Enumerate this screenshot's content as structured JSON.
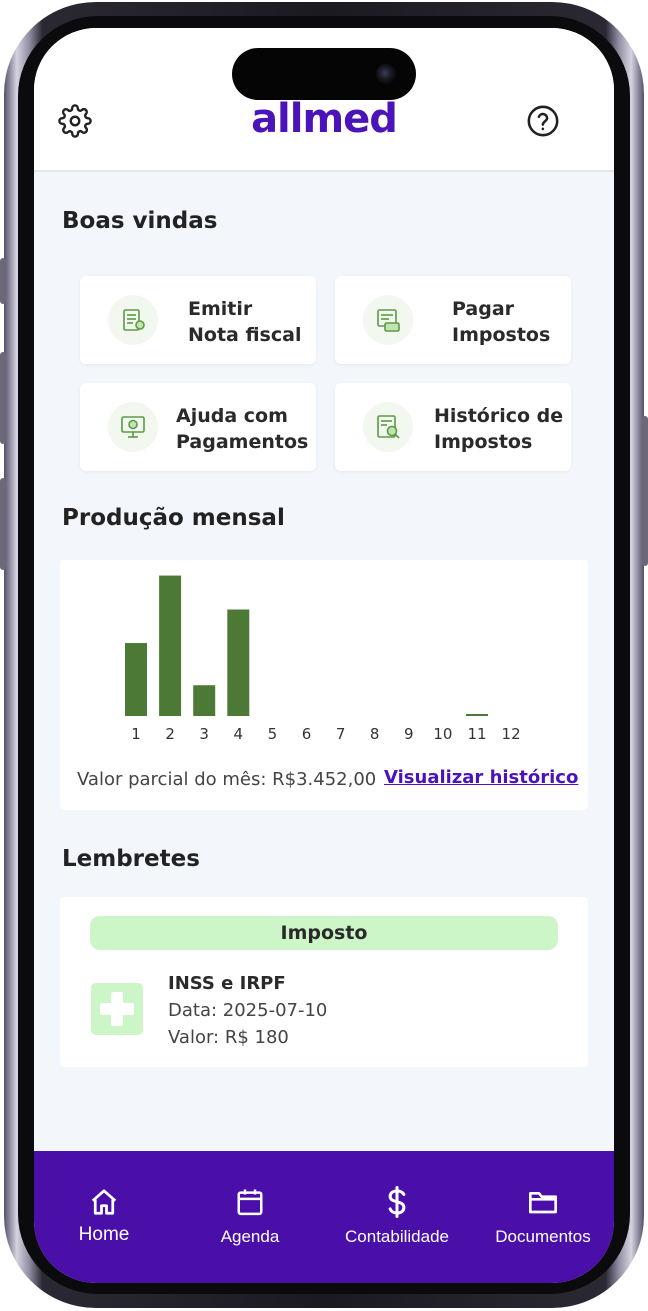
{
  "app": {
    "logo_text": "allmed",
    "brand_color": "#4a14b8",
    "accent_green": "#4c7a36"
  },
  "header": {
    "settings_icon": "gear-icon",
    "help_icon": "help-circle-icon"
  },
  "welcome": {
    "title": "Boas vindas",
    "actions": [
      {
        "label": "Emitir\nNota fiscal",
        "icon": "invoice-icon"
      },
      {
        "label": "Pagar\nImpostos",
        "icon": "tax-payment-icon"
      },
      {
        "label": "Ajuda com\nPagamentos",
        "icon": "payment-help-icon"
      },
      {
        "label": "Histórico de\nImpostos",
        "icon": "tax-history-icon"
      }
    ]
  },
  "production": {
    "title": "Produção mensal",
    "partial_label": "Valor parcial do mês: R$3.452,00",
    "history_link": "Visualizar histórico"
  },
  "chart_data": {
    "type": "bar",
    "title": "",
    "xlabel": "",
    "ylabel": "",
    "categories": [
      "1",
      "2",
      "3",
      "4",
      "5",
      "6",
      "7",
      "8",
      "9",
      "10",
      "11",
      "12"
    ],
    "values": [
      1850,
      3560,
      780,
      2700,
      0,
      0,
      0,
      0,
      0,
      0,
      40,
      0
    ],
    "ylim": [
      0,
      3600
    ],
    "grid": false,
    "bar_color": "#4c7a36"
  },
  "reminders": {
    "title": "Lembretes",
    "items": [
      {
        "tag": "Imposto",
        "title": "INSS e IRPF",
        "date": "Data: 2025-07-10",
        "value": "Valor: R$ 180",
        "icon": "medical-plus-icon"
      }
    ]
  },
  "nav": {
    "items": [
      {
        "label": "Home",
        "icon": "home-icon",
        "active": true
      },
      {
        "label": "Agenda",
        "icon": "calendar-icon",
        "active": false
      },
      {
        "label": "Contabilidade",
        "icon": "dollar-icon",
        "active": false
      },
      {
        "label": "Documentos",
        "icon": "folder-icon",
        "active": false
      }
    ]
  }
}
